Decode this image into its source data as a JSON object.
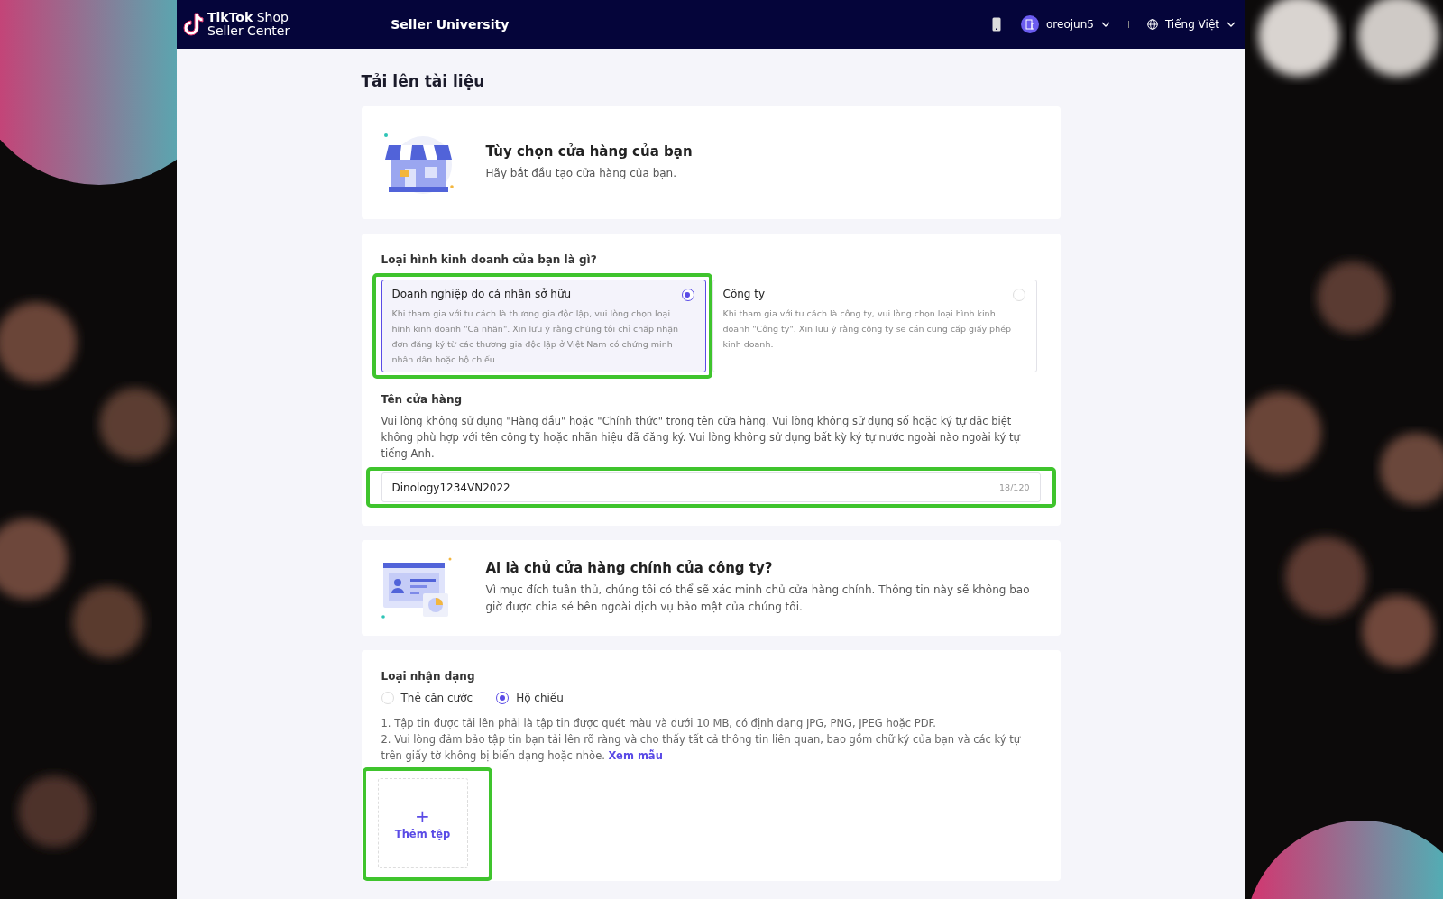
{
  "header": {
    "logo_line_1": "**TikTok** Shop",
    "logo_line_2": "Seller Center",
    "nav_link": "Seller University",
    "username": "oreojun5",
    "language": "Tiếng Việt"
  },
  "page_title": "Tải lên tài liệu",
  "store_intro": {
    "title": "Tùy chọn cửa hàng của bạn",
    "subtitle": "Hãy bắt đầu tạo cửa hàng của bạn."
  },
  "business_type": {
    "label": "Loại hình kinh doanh của bạn là gì?",
    "options": [
      {
        "title": "Doanh nghiệp do cá nhân sở hữu",
        "description": "Khi tham gia với tư cách là thương gia độc lập, vui lòng chọn loại hình kinh doanh \"Cá nhân\". Xin lưu ý rằng chúng tôi chỉ chấp nhận đơn đăng ký từ các thương gia độc lập ở Việt Nam có chứng minh nhân dân hoặc hộ chiếu.",
        "selected": true,
        "highlighted": true
      },
      {
        "title": "Công ty",
        "description": "Khi tham gia với tư cách là công ty, vui lòng chọn loại hình kinh doanh \"Công ty\". Xin lưu ý rằng công ty sẽ cần cung cấp giấy phép kinh doanh.",
        "selected": false,
        "highlighted": false
      }
    ]
  },
  "store_name": {
    "label": "Tên cửa hàng",
    "hint": "Vui lòng không sử dụng \"Hàng đầu\" hoặc \"Chính thức\" trong tên cửa hàng. Vui lòng không sử dụng số hoặc ký tự đặc biệt không phù hợp với tên công ty hoặc nhãn hiệu đã đăng ký. Vui lòng không sử dụng bất kỳ ký tự nước ngoài nào ngoài ký tự tiếng Anh.",
    "value": "Dinology1234VN2022",
    "counter": "18/120",
    "highlighted": true
  },
  "owner_intro": {
    "title": "Ai là chủ cửa hàng chính của công ty?",
    "text": "Vì mục đích tuân thủ, chúng tôi có thể sẽ xác minh chủ cửa hàng chính. Thông tin này sẽ không bao giờ được chia sẻ bên ngoài dịch vụ bảo mật của chúng tôi."
  },
  "identification": {
    "label": "Loại nhận dạng",
    "options": [
      {
        "label": "Thẻ căn cước",
        "selected": false
      },
      {
        "label": "Hộ chiếu",
        "selected": true
      }
    ],
    "notes": [
      {
        "text": "1. Tập tin được tải lên phải là tập tin được quét màu và dưới 10 MB, có định dạng JPG, PNG, JPEG hoặc PDF."
      },
      {
        "text": "2. Vui lòng đảm bảo tập tin bạn tải lên rõ ràng và cho thấy tất cả thông tin liên quan, bao gồm chữ ký của bạn và các ký tự trên giấy tờ không bị biến dạng hoặc nhòe.",
        "link": "Xem mẫu"
      }
    ],
    "upload": {
      "icon": "+",
      "label": "Thêm tệp",
      "highlighted": true
    }
  }
}
